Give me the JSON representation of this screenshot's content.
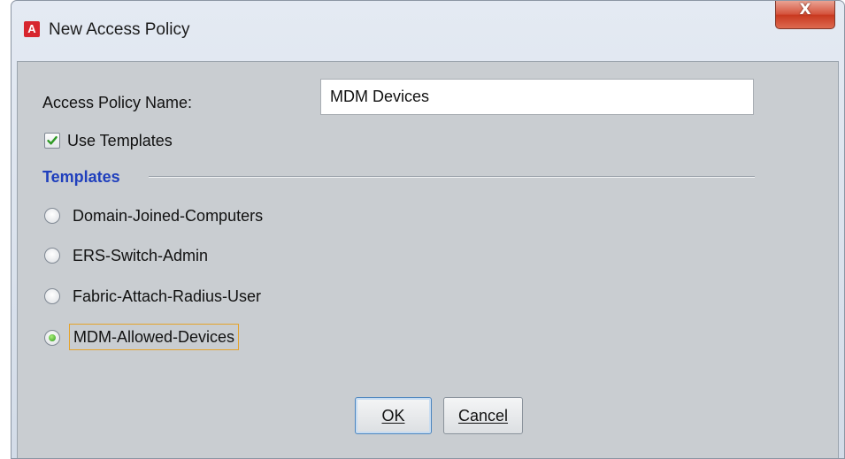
{
  "window": {
    "icon_letter": "A",
    "title": "New Access Policy",
    "close_label": "X"
  },
  "form": {
    "name_label": "Access Policy Name:",
    "name_value": "MDM Devices",
    "use_templates": {
      "label": "Use Templates",
      "checked": true
    }
  },
  "templates": {
    "section_title": "Templates",
    "options": [
      {
        "label": "Domain-Joined-Computers",
        "selected": false
      },
      {
        "label": "ERS-Switch-Admin",
        "selected": false
      },
      {
        "label": "Fabric-Attach-Radius-User",
        "selected": false
      },
      {
        "label": "MDM-Allowed-Devices",
        "selected": true
      }
    ]
  },
  "buttons": {
    "ok": "OK",
    "cancel": "Cancel"
  },
  "colors": {
    "section_title": "#1f3fbd",
    "close_button": "#c8381f",
    "app_icon": "#d7262e",
    "focus_outline": "#e5a32b"
  }
}
